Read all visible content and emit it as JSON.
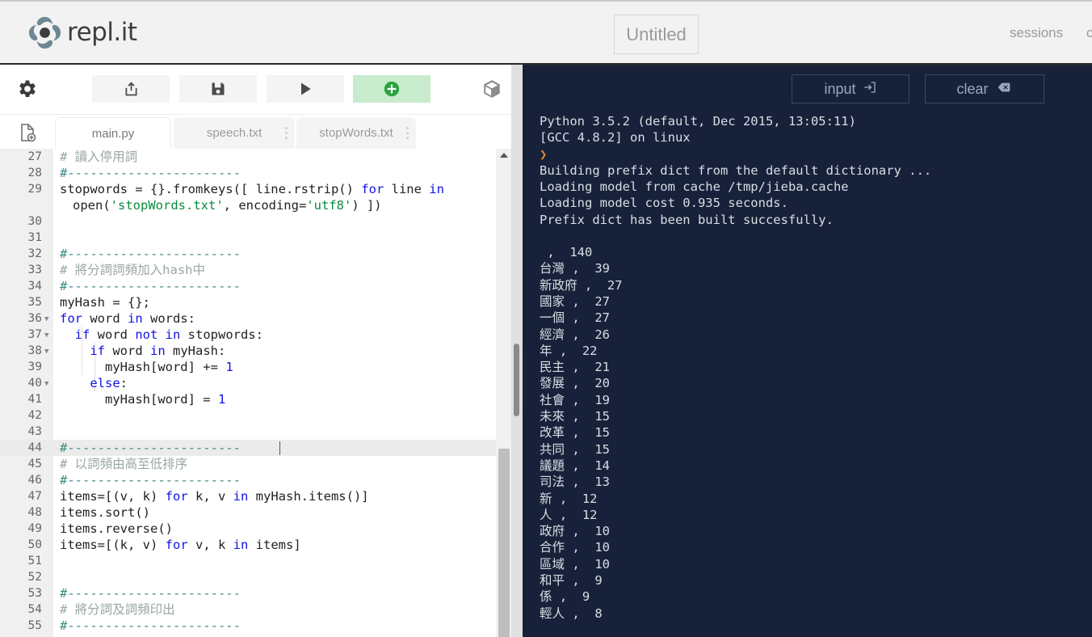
{
  "header": {
    "brand_name": "repl.it",
    "brand_logo_icon": "replit-spiral-logo-icon",
    "title_value": "Untitled",
    "sessions_label": "sessions",
    "clipped_label": "c"
  },
  "toolbar": {
    "gear_icon": "gear-icon",
    "share_icon": "share-export-icon",
    "save_icon": "floppy-save-icon",
    "run_icon": "play-run-icon",
    "add_icon": "plus-circle-add-package-icon",
    "cube_icon": "package-cube-icon",
    "newfile_icon": "new-file-icon"
  },
  "tabs": [
    {
      "label": "main.py",
      "active": true,
      "has_menu": false
    },
    {
      "label": "speech.txt",
      "active": false,
      "has_menu": true
    },
    {
      "label": "stopWords.txt",
      "active": false,
      "has_menu": true
    }
  ],
  "editor": {
    "active_line": 44,
    "lines": [
      {
        "n": "27",
        "fold": false,
        "segs": [
          {
            "t": "# 讀入停用詞",
            "c": "c-comcjk"
          }
        ]
      },
      {
        "n": "28",
        "fold": false,
        "segs": [
          {
            "t": "#-----------------------",
            "c": "c-dash"
          }
        ]
      },
      {
        "n": "29",
        "fold": false,
        "segs": [
          {
            "t": "stopwords = {}.fromkeys([ line.rstrip() ",
            "c": "c-pln"
          },
          {
            "t": "for",
            "c": "c-kw"
          },
          {
            "t": " line ",
            "c": "c-pln"
          },
          {
            "t": "in",
            "c": "c-kw"
          }
        ]
      },
      {
        "n": "",
        "fold": false,
        "cont": true,
        "segs": [
          {
            "t": "open(",
            "c": "c-pln"
          },
          {
            "t": "'stopWords.txt'",
            "c": "c-str"
          },
          {
            "t": ", encoding=",
            "c": "c-pln"
          },
          {
            "t": "'utf8'",
            "c": "c-str"
          },
          {
            "t": ") ])",
            "c": "c-pln"
          }
        ]
      },
      {
        "n": "30",
        "fold": false,
        "segs": []
      },
      {
        "n": "31",
        "fold": false,
        "segs": []
      },
      {
        "n": "32",
        "fold": false,
        "segs": [
          {
            "t": "#-----------------------",
            "c": "c-dash"
          }
        ]
      },
      {
        "n": "33",
        "fold": false,
        "segs": [
          {
            "t": "# 將分詞詞頻加入hash中",
            "c": "c-comcjk"
          }
        ]
      },
      {
        "n": "34",
        "fold": false,
        "segs": [
          {
            "t": "#-----------------------",
            "c": "c-dash"
          }
        ]
      },
      {
        "n": "35",
        "fold": false,
        "segs": [
          {
            "t": "myHash = {};",
            "c": "c-pln"
          }
        ]
      },
      {
        "n": "36",
        "fold": true,
        "segs": [
          {
            "t": "for",
            "c": "c-kw"
          },
          {
            "t": " word ",
            "c": "c-pln"
          },
          {
            "t": "in",
            "c": "c-kw"
          },
          {
            "t": " words:",
            "c": "c-pln"
          }
        ]
      },
      {
        "n": "37",
        "fold": true,
        "segs": [
          {
            "t": "  ",
            "c": "c-pln"
          },
          {
            "t": "if",
            "c": "c-kw"
          },
          {
            "t": " word ",
            "c": "c-pln"
          },
          {
            "t": "not in",
            "c": "c-kw"
          },
          {
            "t": " stopwords:",
            "c": "c-pln"
          }
        ]
      },
      {
        "n": "38",
        "fold": true,
        "segs": [
          {
            "t": "    ",
            "c": "c-pln"
          },
          {
            "t": "if",
            "c": "c-kw"
          },
          {
            "t": " word ",
            "c": "c-pln"
          },
          {
            "t": "in",
            "c": "c-kw"
          },
          {
            "t": " myHash:",
            "c": "c-pln"
          }
        ]
      },
      {
        "n": "39",
        "fold": false,
        "segs": [
          {
            "t": "      myHash[word] += ",
            "c": "c-pln"
          },
          {
            "t": "1",
            "c": "c-num"
          }
        ]
      },
      {
        "n": "40",
        "fold": true,
        "segs": [
          {
            "t": "    ",
            "c": "c-pln"
          },
          {
            "t": "else",
            "c": "c-kw"
          },
          {
            "t": ":",
            "c": "c-pln"
          }
        ]
      },
      {
        "n": "41",
        "fold": false,
        "segs": [
          {
            "t": "      myHash[word] = ",
            "c": "c-pln"
          },
          {
            "t": "1",
            "c": "c-num"
          }
        ]
      },
      {
        "n": "42",
        "fold": false,
        "segs": []
      },
      {
        "n": "43",
        "fold": false,
        "segs": []
      },
      {
        "n": "44",
        "fold": false,
        "active": true,
        "segs": [
          {
            "t": "#-----------------------",
            "c": "c-dash"
          }
        ]
      },
      {
        "n": "45",
        "fold": false,
        "segs": [
          {
            "t": "# 以詞頻由高至低排序",
            "c": "c-comcjk"
          }
        ]
      },
      {
        "n": "46",
        "fold": false,
        "segs": [
          {
            "t": "#-----------------------",
            "c": "c-dash"
          }
        ]
      },
      {
        "n": "47",
        "fold": false,
        "segs": [
          {
            "t": "items=[(v, k) ",
            "c": "c-pln"
          },
          {
            "t": "for",
            "c": "c-kw"
          },
          {
            "t": " k, v ",
            "c": "c-pln"
          },
          {
            "t": "in",
            "c": "c-kw"
          },
          {
            "t": " myHash.items()]",
            "c": "c-pln"
          }
        ]
      },
      {
        "n": "48",
        "fold": false,
        "segs": [
          {
            "t": "items.sort()",
            "c": "c-pln"
          }
        ]
      },
      {
        "n": "49",
        "fold": false,
        "segs": [
          {
            "t": "items.reverse()",
            "c": "c-pln"
          }
        ]
      },
      {
        "n": "50",
        "fold": false,
        "segs": [
          {
            "t": "items=[(k, v) ",
            "c": "c-pln"
          },
          {
            "t": "for",
            "c": "c-kw"
          },
          {
            "t": " v, k ",
            "c": "c-pln"
          },
          {
            "t": "in",
            "c": "c-kw"
          },
          {
            "t": " items]",
            "c": "c-pln"
          }
        ]
      },
      {
        "n": "51",
        "fold": false,
        "segs": []
      },
      {
        "n": "52",
        "fold": false,
        "segs": []
      },
      {
        "n": "53",
        "fold": false,
        "segs": [
          {
            "t": "#-----------------------",
            "c": "c-dash"
          }
        ]
      },
      {
        "n": "54",
        "fold": false,
        "segs": [
          {
            "t": "# 將分詞及詞頻印出",
            "c": "c-comcjk"
          }
        ]
      },
      {
        "n": "55",
        "fold": false,
        "segs": [
          {
            "t": "#-----------------------",
            "c": "c-dash"
          }
        ]
      }
    ]
  },
  "console": {
    "input_label": "input",
    "input_icon": "sign-in-arrow-icon",
    "clear_label": "clear",
    "clear_icon": "backspace-delete-icon",
    "output_lines": [
      "Python 3.5.2 (default, Dec 2015, 13:05:11)",
      "[GCC 4.8.2] on linux",
      "PROMPT",
      "Building prefix dict from the default dictionary ...",
      "Loading model from cache /tmp/jieba.cache",
      "Loading model cost 0.935 seconds.",
      "Prefix dict has been built succesfully.",
      "",
      " ,  140",
      "台灣 ,  39",
      "新政府 ,  27",
      "國家 ,  27",
      "一個 ,  27",
      "經濟 ,  26",
      "年 ,  22",
      "民主 ,  21",
      "發展 ,  20",
      "社會 ,  19",
      "未來 ,  15",
      "改革 ,  15",
      "共同 ,  15",
      "議題 ,  14",
      "司法 ,  13",
      "新 ,  12",
      "人 ,  12",
      "政府 ,  10",
      "合作 ,  10",
      "區域 ,  10",
      "和平 ,  9",
      "係 ,  9",
      "輕人 ,  8"
    ],
    "prompt_symbol": "❯"
  },
  "colors": {
    "console_bg": "#17223a",
    "accent_green": "#28a745",
    "add_button_bg": "#c8ebcd",
    "prompt_orange": "#d98a2b"
  }
}
